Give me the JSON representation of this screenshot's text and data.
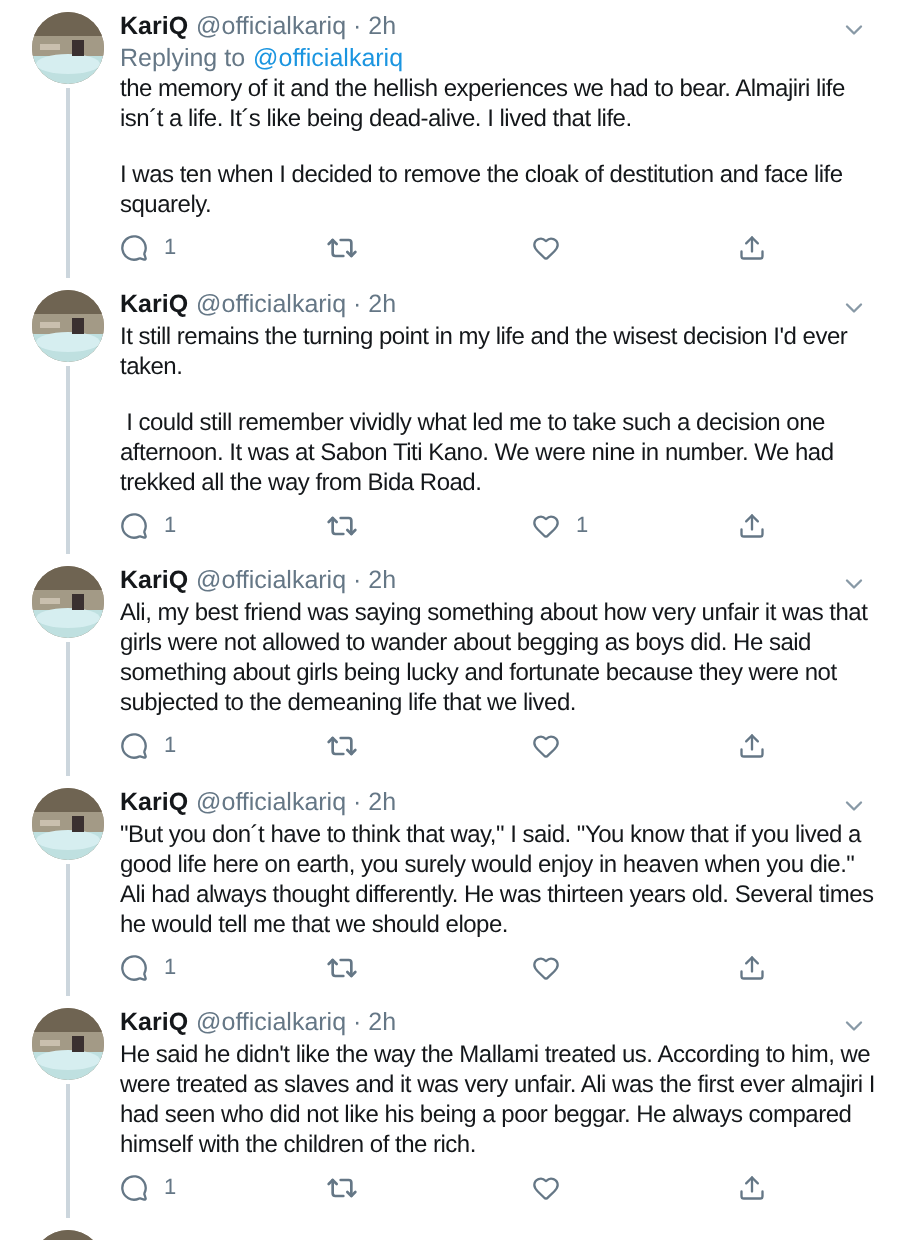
{
  "tweets": [
    {
      "name": "KariQ",
      "meta": "@officialkariq · 2h",
      "reply_prefix": "Replying to",
      "reply_handle": "@officialkariq",
      "paragraphs": [
        "the memory of it and the hellish experiences we had to bear. Almajiri life isn´t a life. It´s like being dead-alive. I lived that life.",
        "I was ten when I decided to remove the cloak of destitution and face life squarely."
      ],
      "replies": "1"
    },
    {
      "name": "KariQ",
      "meta": "@officialkariq · 2h",
      "paragraphs": [
        "It still remains the turning point in my life and the wisest decision I'd ever taken.",
        " I could still remember vividly what led me to take such a decision one afternoon. It was at Sabon Titi Kano. We were nine in number. We had trekked all the way from Bida Road."
      ],
      "replies": "1",
      "likes": "1"
    },
    {
      "name": "KariQ",
      "meta": "@officialkariq · 2h",
      "paragraphs": [
        "Ali, my best friend was saying something about how very unfair it was that girls were not allowed to wander about begging as boys did. He said something about girls being lucky and fortunate because they were not subjected to the demeaning life that we lived."
      ],
      "replies": "1"
    },
    {
      "name": "KariQ",
      "meta": "@officialkariq · 2h",
      "paragraphs": [
        "\"But you don´t have to think that way,\" I said. \"You know that if you lived a good life here on earth, you surely would enjoy in heaven when you die.\" Ali had always thought differently. He was thirteen years old. Several times he would tell me that we should elope."
      ],
      "replies": "1"
    },
    {
      "name": "KariQ",
      "meta": "@officialkariq · 2h",
      "paragraphs": [
        "He said he didn't like the way the Mallami treated us. According to him, we were treated as slaves and it was very unfair. Ali was the first ever almajiri I had seen who did not like his being a poor beggar. He always compared himself with the children of the rich."
      ],
      "replies": "1"
    },
    {
      "avatar": {
        "kind": "picture"
      }
    }
  ]
}
